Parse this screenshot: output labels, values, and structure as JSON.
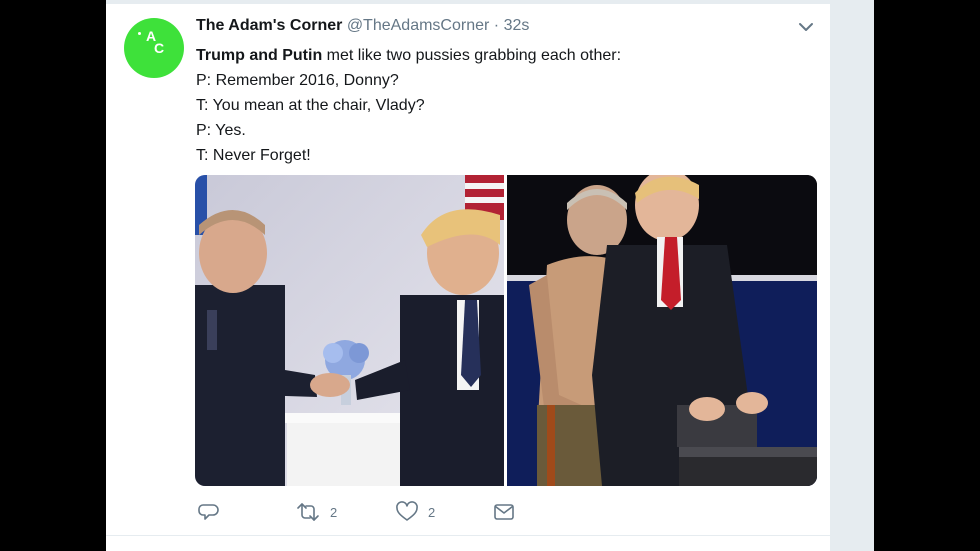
{
  "tweet": {
    "author_name": "The Adam's Corner",
    "author_handle": "@TheAdamsCorner",
    "separator": "·",
    "timestamp": "32s",
    "avatar_initials": [
      "A",
      "C"
    ],
    "lines": [
      {
        "bold": "Trump and Putin",
        "rest": " met like two pussies grabbing each other:"
      },
      {
        "text": "P: Remember 2016, Donny?"
      },
      {
        "text": "T: You mean at the chair, Vlady?"
      },
      {
        "text": "P: Yes."
      },
      {
        "text": "T: Never Forget!"
      }
    ],
    "media": [
      {
        "icon": "handshake-photo"
      },
      {
        "icon": "debate-photo"
      }
    ]
  },
  "actions": {
    "reply": {
      "icon": "reply-icon",
      "count": ""
    },
    "retweet": {
      "icon": "retweet-icon",
      "count": "2"
    },
    "like": {
      "icon": "heart-icon",
      "count": "2"
    },
    "dm": {
      "icon": "envelope-icon",
      "count": ""
    }
  },
  "colors": {
    "background_side": "#000000",
    "gutter": "#e6ecf0",
    "card": "#ffffff",
    "avatar": "#3ee13a",
    "text_primary": "#14171a",
    "text_secondary": "#657786"
  }
}
